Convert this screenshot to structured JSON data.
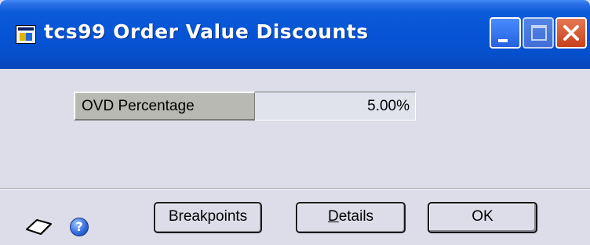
{
  "window": {
    "title": "tcs99 Order Value Discounts",
    "icon": "app-window-icon",
    "controls": {
      "minimize": "minimize-icon",
      "maximize": "maximize-icon",
      "close": "close-icon"
    }
  },
  "form": {
    "field_label": "OVD Percentage",
    "field_value": "5.00%"
  },
  "buttons": {
    "breakpoints": "Breakpoints",
    "details_mnemonic": "D",
    "details_rest": "etails",
    "ok": "OK"
  },
  "footer_icons": {
    "note": "note-icon",
    "help": "help-icon",
    "help_glyph": "?"
  },
  "colors": {
    "title_bar": "#0553d4",
    "window_bg": "#dcdde8",
    "label_bg": "#b7b9b2",
    "value_bg": "#e1e3ec",
    "close_button": "#c7401c"
  }
}
